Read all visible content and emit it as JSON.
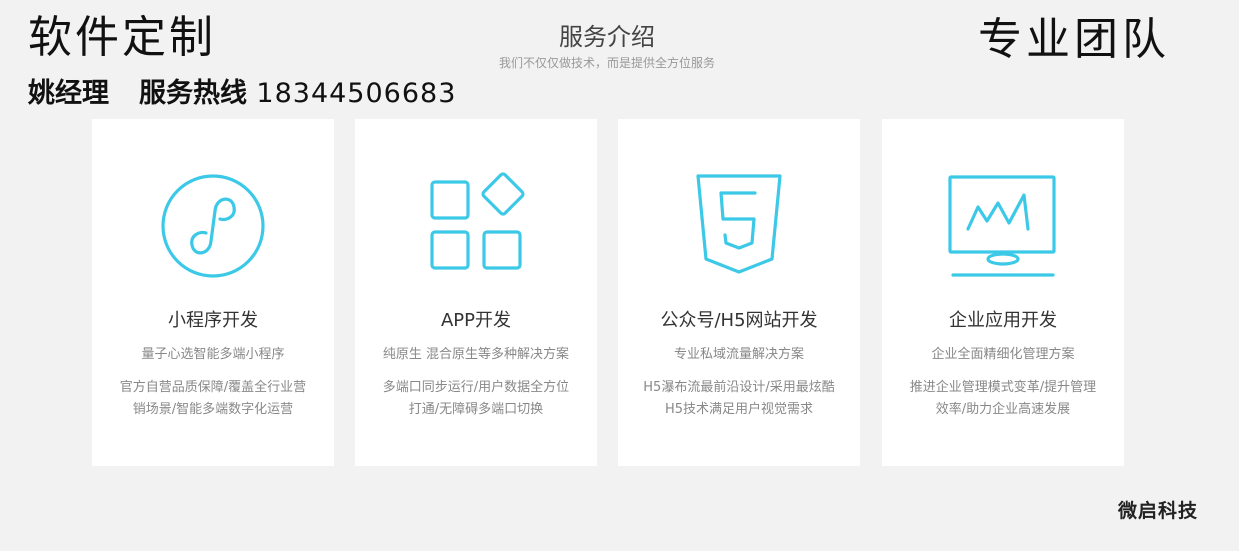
{
  "header": {
    "brand_left": "软件定制",
    "contact_name": "姚经理",
    "hotline_label": "服务热线",
    "phone": "18344506683",
    "brand_right": "专业团队"
  },
  "section": {
    "title": "服务介绍",
    "subtitle": "我们不仅仅做技术，而是提供全方位服务"
  },
  "accent_color": "#3cc9e8",
  "cards": [
    {
      "icon": "mini-program-icon",
      "title": "小程序开发",
      "subtitle": "量子心选智能多端小程序",
      "desc": [
        "官方自营品质保障/覆盖全行业营",
        "销场景/智能多端数字化运营"
      ]
    },
    {
      "icon": "app-grid-icon",
      "title": "APP开发",
      "subtitle": "纯原生 混合原生等多种解决方案",
      "desc": [
        "多端口同步运行/用户数据全方位",
        "打通/无障碍多端口切换"
      ]
    },
    {
      "icon": "html5-icon",
      "title": "公众号/H5网站开发",
      "subtitle": "专业私域流量解决方案",
      "desc": [
        "H5瀑布流最前沿设计/采用最炫酷",
        "H5技术满足用户视觉需求"
      ]
    },
    {
      "icon": "monitor-chart-icon",
      "title": "企业应用开发",
      "subtitle": "企业全面精细化管理方案",
      "desc": [
        "推进企业管理模式变革/提升管理",
        "效率/助力企业高速发展"
      ]
    }
  ],
  "watermark": "微启科技"
}
